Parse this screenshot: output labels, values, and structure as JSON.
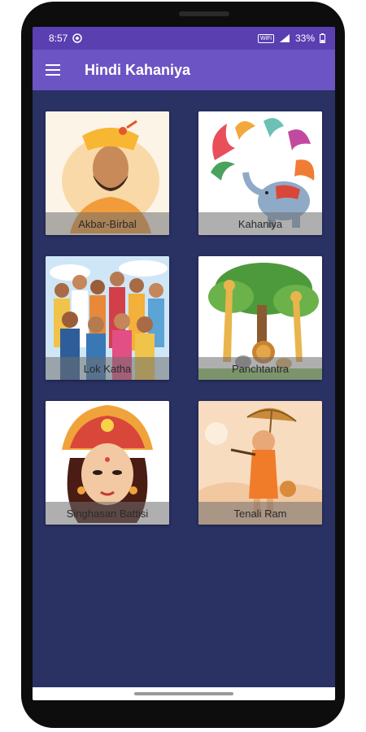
{
  "status_bar": {
    "time": "8:57",
    "wifi_tag": "WiFi",
    "battery": "33%"
  },
  "app_bar": {
    "title": "Hindi Kahaniya",
    "menu_icon": "hamburger-menu-icon"
  },
  "categories": [
    {
      "label": "Akbar-Birbal",
      "icon": "akbar-portrait-image"
    },
    {
      "label": "Kahaniya",
      "icon": "elephant-paisley-image"
    },
    {
      "label": "Lok Katha",
      "icon": "people-crowd-image"
    },
    {
      "label": "Panchtantra",
      "icon": "animals-tree-image"
    },
    {
      "label": "Singhasan Battisi",
      "icon": "goddess-crown-image"
    },
    {
      "label": "Tenali Ram",
      "icon": "boy-umbrella-image"
    }
  ],
  "colors": {
    "status_bar": "#5a3fb1",
    "app_bar": "#6d54c4",
    "background": "#2a3163"
  }
}
